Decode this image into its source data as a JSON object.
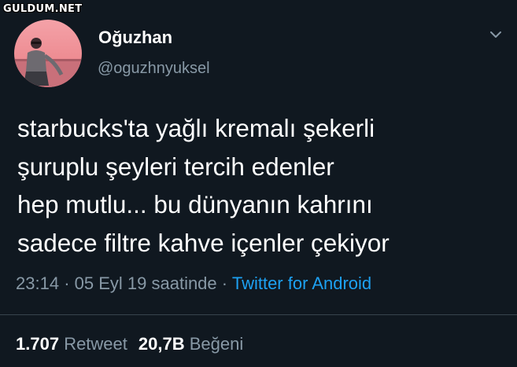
{
  "watermark": "GULDUM.NET",
  "user": {
    "display_name": "Oğuzhan",
    "handle": "@oguzhnyuksel"
  },
  "tweet": {
    "lines": [
      "starbucks'ta yağlı kremalı şekerli",
      "şuruplu şeyleri tercih edenler",
      "hep mutlu... bu dünyanın kahrını",
      "sadece filtre kahve içenler çekiyor"
    ],
    "time": "23:14",
    "separator": "·",
    "date": "05 Eyl 19 saatinde",
    "client": "Twitter for Android"
  },
  "stats": {
    "retweet_count": "1.707",
    "retweet_label": "Retweet",
    "like_count": "20,7B",
    "like_label": "Beğeni"
  },
  "icons": {
    "menu": "chevron-down-icon"
  },
  "colors": {
    "background": "#101820",
    "secondary_text": "#8899a6",
    "link": "#1da1f2",
    "divider": "#38444d"
  }
}
